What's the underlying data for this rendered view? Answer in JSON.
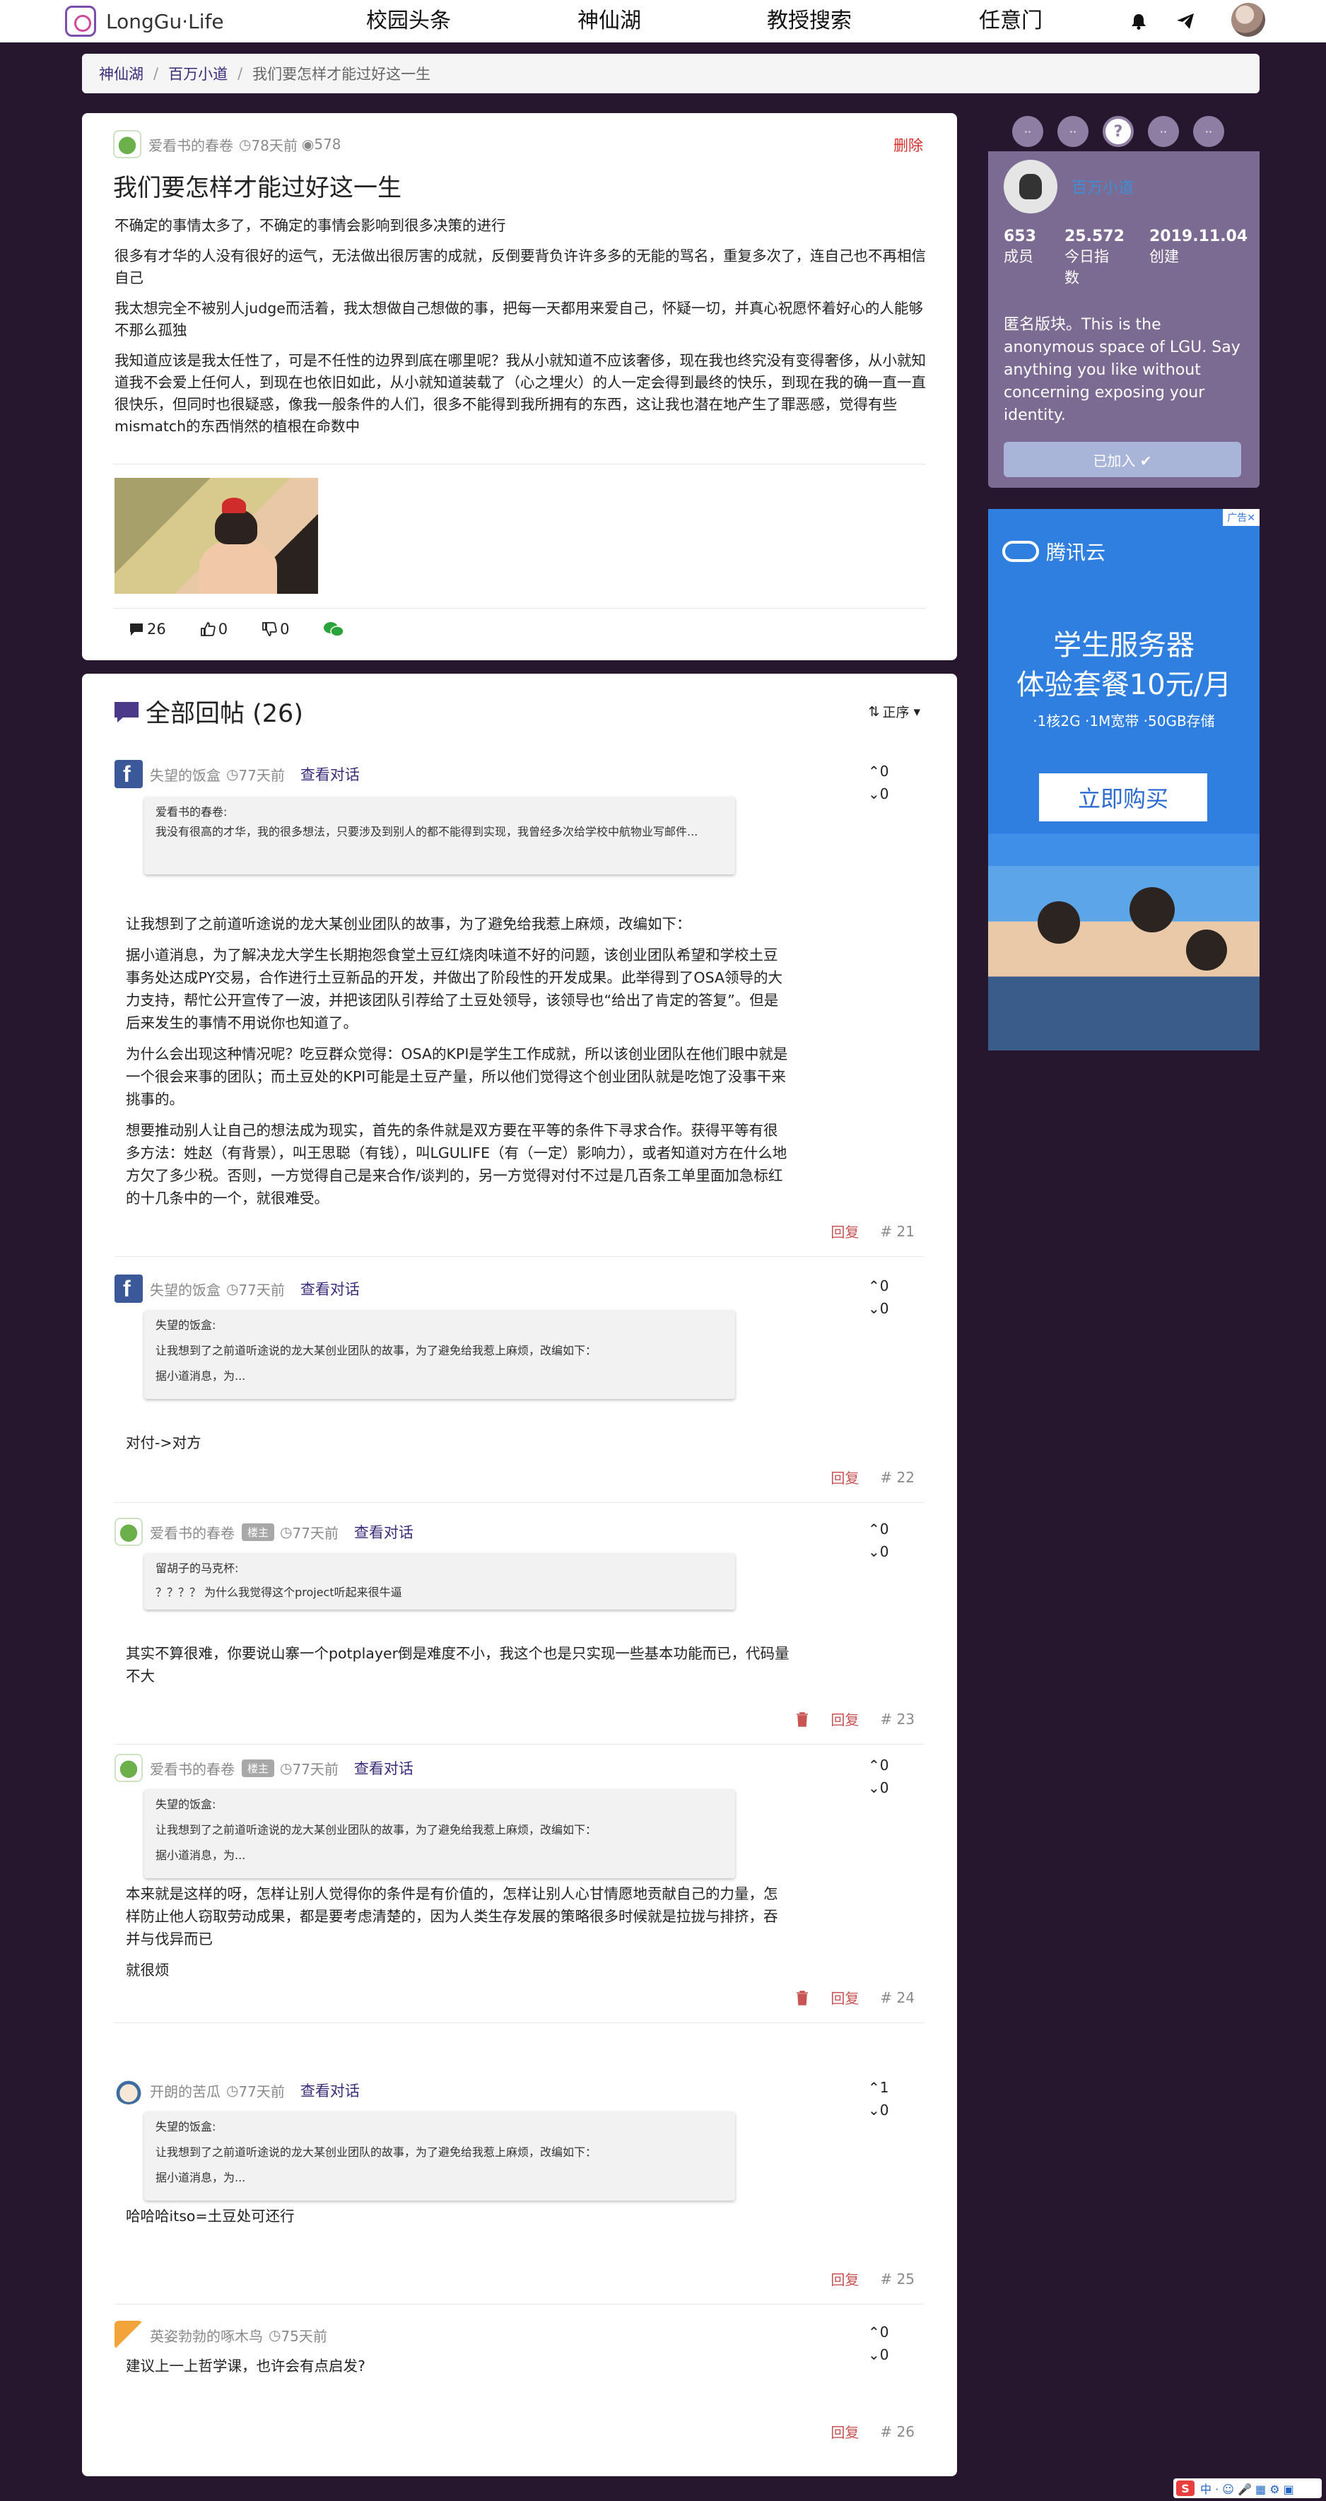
{
  "nav": {
    "brand": "LongGu·Life",
    "items": [
      "校园头条",
      "神仙湖",
      "教授搜索",
      "任意门"
    ],
    "bell_icon": "bell-icon",
    "send_icon": "paper-plane-icon"
  },
  "breadcrumb": [
    "神仙湖",
    "百万小道",
    "我们要怎样才能过好这一生"
  ],
  "post": {
    "author": "爱看书的春卷",
    "time": "78天前",
    "views": "578",
    "delete": "删除",
    "title": "我们要怎样才能过好这一生",
    "paragraphs": [
      "不确定的事情太多了，不确定的事情会影响到很多决策的进行",
      "很多有才华的人没有很好的运气，无法做出很厉害的成就，反倒要背负许许多多的无能的骂名，重复多次了，连自己也不再相信自己",
      "我太想完全不被别人judge而活着，我太想做自己想做的事，把每一天都用来爱自己，怀疑一切，并真心祝愿怀着好心的人能够不那么孤独",
      "我知道应该是我太任性了，可是不任性的边界到底在哪里呢？我从小就知道不应该奢侈，现在我也终究没有变得奢侈，从小就知道我不会爱上任何人，到现在也依旧如此，从小就知道装载了（心之埋火）的人一定会得到最终的快乐，到现在我的确一直一直很快乐，但同时也很疑惑，像我一般条件的人们，很多不能得到我所拥有的东西，这让我也潜在地产生了罪恶感，觉得有些mismatch的东西悄然的植根在命数中"
    ],
    "comments": "26",
    "likes": "0",
    "dislikes": "0"
  },
  "sidebar": {
    "dots": [
      "··",
      "··",
      "?",
      "··",
      "··"
    ],
    "board_name": "百万小道",
    "members_num": "653",
    "members_label": "成员",
    "index_num": "25.572",
    "index_label": "今日指数",
    "created_num": "2019.11.04",
    "created_label": "创建",
    "description": "匿名版块。This is the anonymous space of LGU. Say anything you like without concerning exposing your identity.",
    "join": "已加入 ✔"
  },
  "ad": {
    "tag": "广告✕",
    "brand": "腾讯云",
    "line1": "学生服务器",
    "line2": "体验套餐10元/月",
    "sub": "·1核2G ·1M宽带 ·50GB存储",
    "button": "立即购买"
  },
  "replies_header": {
    "title": "全部回帖 (26)",
    "sort": "正序"
  },
  "replies": [
    {
      "author": "失望的饭盒",
      "time": "77天前",
      "view": "查看对话",
      "up": "0",
      "down": "0",
      "quote": [
        "爱看书的春卷:",
        "我没有很高的才华，我的很多想法，只要涉及到别人的都不能得到实现，我曾经多次给学校中航物业写邮件..."
      ],
      "text": [
        "让我想到了之前道听途说的龙大某创业团队的故事，为了避免给我惹上麻烦，改编如下：",
        "据小道消息，为了解决龙大学生长期抱怨食堂土豆红烧肉味道不好的问题，该创业团队希望和学校土豆事务处达成PY交易，合作进行土豆新品的开发，并做出了阶段性的开发成果。此举得到了OSA领导的大力支持，帮忙公开宣传了一波，并把该团队引荐给了土豆处领导，该领导也“给出了肯定的答复”。但是后来发生的事情不用说你也知道了。",
        "为什么会出现这种情况呢？吃豆群众觉得：OSA的KPI是学生工作成就，所以该创业团队在他们眼中就是一个很会来事的团队；而土豆处的KPI可能是土豆产量，所以他们觉得这个创业团队就是吃饱了没事干来挑事的。",
        "想要推动别人让自己的想法成为现实，首先的条件就是双方要在平等的条件下寻求合作。获得平等有很多方法：姓赵（有背景），叫王思聪（有钱），叫LGULIFE（有（一定）影响力），或者知道对方在什么地方欠了多少税。否则，一方觉得自己是来合作/谈判的，另一方觉得对付不过是几百条工单里面加急标红的十几条中的一个，就很难受。"
      ],
      "reply": "回复",
      "num": "# 21"
    },
    {
      "author": "失望的饭盒",
      "time": "77天前",
      "view": "查看对话",
      "up": "0",
      "down": "0",
      "quote": [
        "失望的饭盒:",
        "让我想到了之前道听途说的龙大某创业团队的故事，为了避免给我惹上麻烦，改编如下：",
        "据小道消息，为..."
      ],
      "text": [
        "对付->对方"
      ],
      "reply": "回复",
      "num": "# 22"
    },
    {
      "author": "爱看书的春卷",
      "owner": "楼主",
      "time": "77天前",
      "view": "查看对话",
      "up": "0",
      "down": "0",
      "quote": [
        "留胡子的马克杯:",
        "？？？？ 为什么我觉得这个project听起来很牛逼"
      ],
      "text": [
        "其实不算很难，你要说山寨一个potplayer倒是难度不小，我这个也是只实现一些基本功能而已，代码量不大"
      ],
      "reply": "回复",
      "num": "# 23"
    },
    {
      "author": "爱看书的春卷",
      "owner": "楼主",
      "time": "77天前",
      "view": "查看对话",
      "up": "0",
      "down": "0",
      "quote": [
        "失望的饭盒:",
        "让我想到了之前道听途说的龙大某创业团队的故事，为了避免给我惹上麻烦，改编如下：",
        "据小道消息，为..."
      ],
      "text": [
        "本来就是这样的呀，怎样让别人觉得你的条件是有价值的，怎样让别人心甘情愿地贡献自己的力量，怎样防止他人窃取劳动成果，都是要考虑清楚的，因为人类生存发展的策略很多时候就是拉拢与排挤，吞并与伐异而已",
        "就很烦"
      ],
      "reply": "回复",
      "num": "# 24"
    },
    {
      "author": "开朗的苦瓜",
      "time": "77天前",
      "view": "查看对话",
      "up": "1",
      "down": "0",
      "quote": [
        "失望的饭盒:",
        "让我想到了之前道听途说的龙大某创业团队的故事，为了避免给我惹上麻烦，改编如下：",
        "据小道消息，为..."
      ],
      "text": [
        "哈哈哈itso=土豆处可还行"
      ],
      "reply": "回复",
      "num": "# 25"
    },
    {
      "author": "英姿勃勃的啄木鸟",
      "time": "75天前",
      "up": "0",
      "down": "0",
      "text": [
        "建议上一上哲学课，也许会有点启发?"
      ],
      "reply": "回复",
      "num": "# 26"
    }
  ],
  "ime": "中 · ☺ 🎤 ▦ ⚙ ▣"
}
